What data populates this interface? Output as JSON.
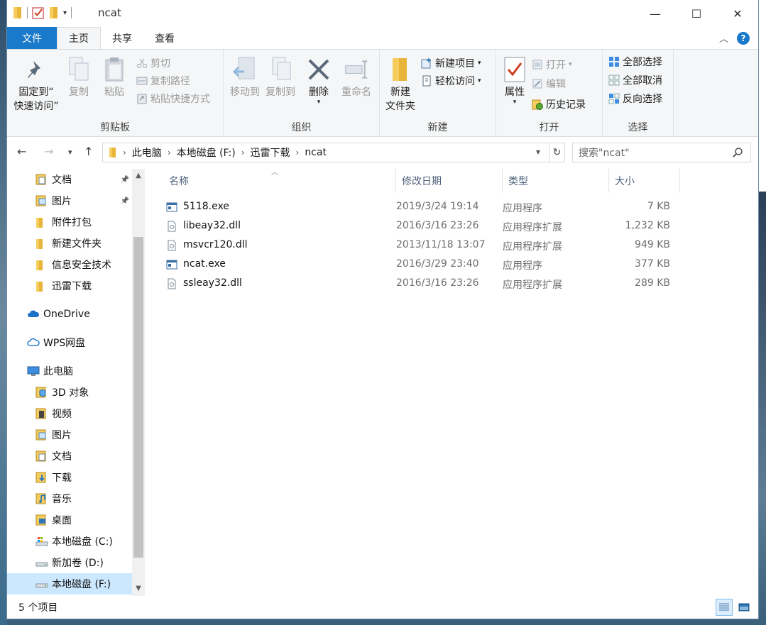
{
  "window": {
    "title": "ncat"
  },
  "window_buttons": {
    "minimize": "—",
    "maximize": "☐",
    "close": "✕"
  },
  "ribbon_tabs": [
    {
      "label": "文件"
    },
    {
      "label": "主页"
    },
    {
      "label": "共享"
    },
    {
      "label": "查看"
    }
  ],
  "ribbon": {
    "clipboard": {
      "group_label": "剪贴板",
      "pin_label_1": "固定到“",
      "pin_label_2": "快速访问”",
      "copy": "复制",
      "paste": "粘贴",
      "cut": "剪切",
      "copy_path": "复制路径",
      "paste_shortcut": "粘贴快捷方式"
    },
    "organize": {
      "group_label": "组织",
      "move_to": "移动到",
      "copy_to": "复制到",
      "delete": "删除",
      "rename": "重命名"
    },
    "new": {
      "group_label": "新建",
      "new_folder_1": "新建",
      "new_folder_2": "文件夹",
      "new_item": "新建项目",
      "easy_access": "轻松访问"
    },
    "open": {
      "group_label": "打开",
      "properties": "属性",
      "open": "打开",
      "edit": "编辑",
      "history": "历史记录"
    },
    "select": {
      "group_label": "选择",
      "select_all": "全部选择",
      "select_none": "全部取消",
      "invert": "反向选择"
    }
  },
  "address": {
    "breadcrumb": [
      "此电脑",
      "本地磁盘 (F:)",
      "迅雷下载",
      "ncat"
    ],
    "search_placeholder": "搜索\"ncat\""
  },
  "nav_pane": {
    "items": [
      {
        "label": "文档",
        "icon": "doc",
        "pinned": true
      },
      {
        "label": "图片",
        "icon": "pic",
        "pinned": true
      },
      {
        "label": "附件打包",
        "icon": "folder"
      },
      {
        "label": "新建文件夹",
        "icon": "folder"
      },
      {
        "label": "信息安全技术",
        "icon": "folder"
      },
      {
        "label": "迅雷下载",
        "icon": "folder"
      },
      {
        "label": "OneDrive",
        "icon": "cloud"
      },
      {
        "label": "WPS网盘",
        "icon": "cloud-outline"
      },
      {
        "label": "此电脑",
        "icon": "pc"
      },
      {
        "label": "3D 对象",
        "icon": "3d"
      },
      {
        "label": "视频",
        "icon": "video"
      },
      {
        "label": "图片",
        "icon": "pic"
      },
      {
        "label": "文档",
        "icon": "doc"
      },
      {
        "label": "下载",
        "icon": "download"
      },
      {
        "label": "音乐",
        "icon": "music"
      },
      {
        "label": "桌面",
        "icon": "desktop"
      },
      {
        "label": "本地磁盘 (C:)",
        "icon": "drive-c"
      },
      {
        "label": "新加卷 (D:)",
        "icon": "drive"
      },
      {
        "label": "本地磁盘 (F:)",
        "icon": "drive",
        "selected": true
      }
    ]
  },
  "file_list": {
    "columns": {
      "name": "名称",
      "date": "修改日期",
      "type": "类型",
      "size": "大小"
    },
    "rows": [
      {
        "name": "5118.exe",
        "date": "2019/3/24 19:14",
        "type": "应用程序",
        "size": "7 KB",
        "icon": "exe"
      },
      {
        "name": "libeay32.dll",
        "date": "2016/3/16 23:26",
        "type": "应用程序扩展",
        "size": "1,232 KB",
        "icon": "dll"
      },
      {
        "name": "msvcr120.dll",
        "date": "2013/11/18 13:07",
        "type": "应用程序扩展",
        "size": "949 KB",
        "icon": "dll"
      },
      {
        "name": "ncat.exe",
        "date": "2016/3/29 23:40",
        "type": "应用程序",
        "size": "377 KB",
        "icon": "exe"
      },
      {
        "name": "ssleay32.dll",
        "date": "2016/3/16 23:26",
        "type": "应用程序扩展",
        "size": "289 KB",
        "icon": "dll"
      }
    ]
  },
  "status": {
    "item_count": "5 个项目"
  }
}
